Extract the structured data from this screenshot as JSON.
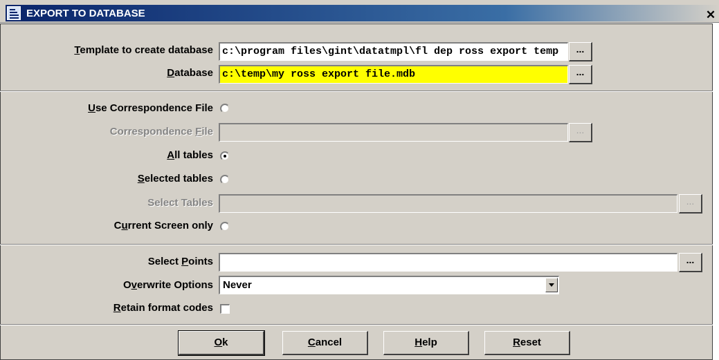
{
  "window": {
    "title": "EXPORT TO DATABASE",
    "close_glyph": "✕"
  },
  "template_row": {
    "label_mnemonic": "T",
    "label_rest": "emplate to create database",
    "value": "c:\\program files\\gint\\datatmpl\\fl dep ross export temp",
    "browse_label": "..."
  },
  "database_row": {
    "label_mnemonic": "D",
    "label_rest": "atabase",
    "value": "c:\\temp\\my ross export file.mdb",
    "browse_label": "...",
    "highlight_color": "#ffff00"
  },
  "use_correspondence": {
    "label_mnemonic": "U",
    "label_rest": "se Correspondence File",
    "selected": false
  },
  "correspondence_file": {
    "label_pre": "Correspondence ",
    "label_mnemonic": "F",
    "label_rest": "ile",
    "value": "",
    "browse_label": "..."
  },
  "all_tables": {
    "label_mnemonic": "A",
    "label_rest": "ll tables",
    "selected": true
  },
  "selected_tables": {
    "label_mnemonic": "S",
    "label_rest": "elected tables",
    "selected": false
  },
  "select_tables": {
    "label": "Select Tables",
    "value": "",
    "browse_label": "..."
  },
  "current_screen": {
    "label_pre": "C",
    "label_mnemonic": "u",
    "label_rest": "rrent Screen only",
    "selected": false
  },
  "select_points": {
    "label_pre": "Select ",
    "label_mnemonic": "P",
    "label_rest": "oints",
    "value": "",
    "browse_label": "..."
  },
  "overwrite_options": {
    "label_pre": "O",
    "label_mnemonic": "v",
    "label_rest": "erwrite Options",
    "value": "Never"
  },
  "retain_format": {
    "label_mnemonic": "R",
    "label_rest": "etain format codes",
    "checked": false
  },
  "buttons": {
    "ok": {
      "mnemonic": "O",
      "rest": "k"
    },
    "cancel": {
      "mnemonic": "C",
      "rest": "ancel"
    },
    "help": {
      "mnemonic": "H",
      "rest": "elp"
    },
    "reset": {
      "mnemonic": "R",
      "rest": "eset"
    }
  }
}
